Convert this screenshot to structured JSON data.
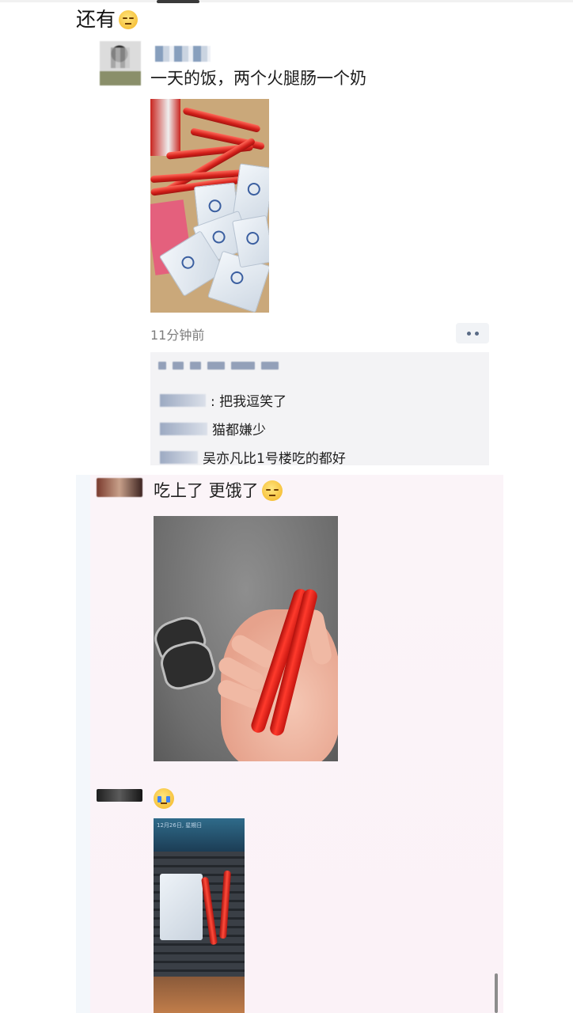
{
  "heading": {
    "text": "还有",
    "emoji_icon": "unamused-face-icon"
  },
  "post1": {
    "text": "一天的饭，两个火腿肠一个奶",
    "time": "11分钟前",
    "comments": [
      {
        "text": ": 把我逗笑了"
      },
      {
        "text": "猫都嫌少"
      },
      {
        "text": "吴亦凡比1号楼吃的都好"
      }
    ]
  },
  "post2": {
    "text": "吃上了 更饿了",
    "emoji_icon": "sad-face-icon"
  },
  "post3": {
    "emoji_icon": "crying-face-icon",
    "photo_date_text": "12月26日, 星期日"
  },
  "colors": {
    "comment_bg": "#f3f3f5",
    "time_text": "#7d7d7d",
    "faded_overlay": "#fbf2f7"
  }
}
